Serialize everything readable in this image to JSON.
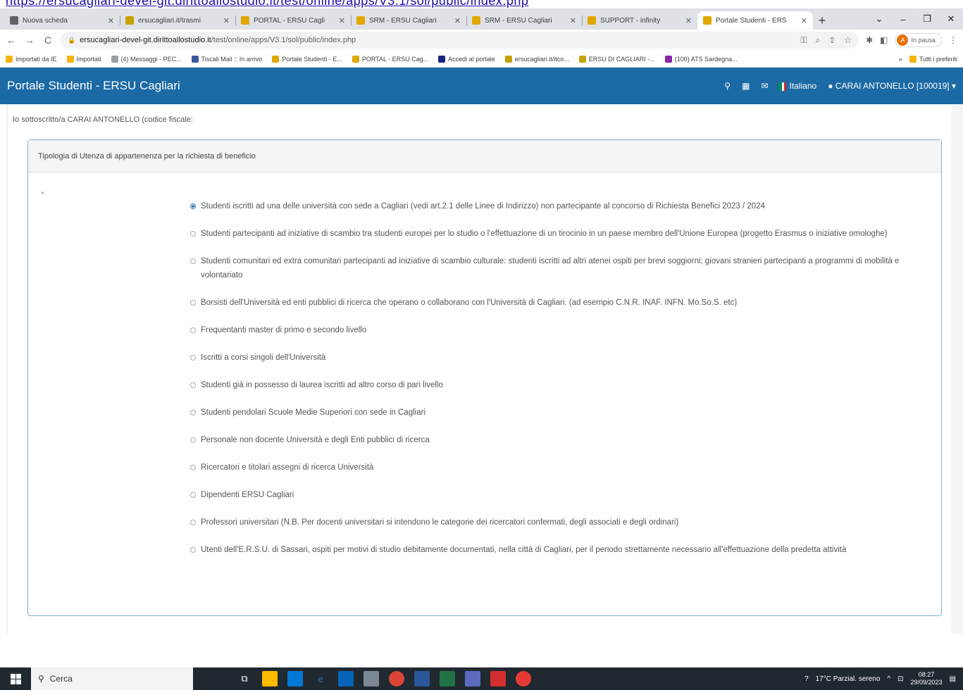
{
  "browser": {
    "tabs": [
      {
        "title": "Nuova scheda",
        "color": "#5f6368"
      },
      {
        "title": "ersucagliari.it/trasmi",
        "color": "#c8a200"
      },
      {
        "title": "PORTAL - ERSU Cagli",
        "color": "#e0a800"
      },
      {
        "title": "SRM - ERSU Cagliari",
        "color": "#e0a800"
      },
      {
        "title": "SRM - ERSU Cagliari",
        "color": "#e0a800"
      },
      {
        "title": "SUPPORT - infinity",
        "color": "#e0a800"
      },
      {
        "title": "Portale Studenti - ERS",
        "color": "#e0a800",
        "active": true
      }
    ],
    "url_host": "ersucagliari-devel-git.dirittoallostudio.it",
    "url_path": "/test/online/apps/V3.1/sol/public/index.php",
    "profile_status": "In pausa",
    "profile_initial": "A",
    "bookmarks": [
      {
        "label": "Importati da IE",
        "color": "#f4b400"
      },
      {
        "label": "Importati",
        "color": "#f4b400"
      },
      {
        "label": "(4) Messaggi - PEC...",
        "color": "#9aa0a6"
      },
      {
        "label": "Tiscali Mail :: In arrivo",
        "color": "#3b5998"
      },
      {
        "label": "Portale Studenti - E...",
        "color": "#e0a800"
      },
      {
        "label": "PORTAL - ERSU Cag...",
        "color": "#e0a800"
      },
      {
        "label": "Accedi al portale",
        "color": "#1a237e"
      },
      {
        "label": "ersucagliari.it/itco...",
        "color": "#c8a200"
      },
      {
        "label": "ERSU DI CAGLIARI -...",
        "color": "#c8a200"
      },
      {
        "label": "(100) ATS Sardegna...",
        "color": "#8e24aa"
      }
    ],
    "all_bookmarks": "Tutti i preferiti"
  },
  "portal": {
    "brand": "Portale Studenti - ERSU Cagliari",
    "language": "Italiano",
    "user": "CARAI ANTONELLO [100019]"
  },
  "form": {
    "intro": "Io sottoscritto/a CARAI ANTONELLO (codice fiscale:",
    "panel_title": "Tipologia di Utenza di appartenenza per la richiesta di beneficio",
    "required_mark": "*",
    "options": [
      {
        "label": "Studenti iscritti ad una delle università con sede a Cagliari (vedi art.2.1 delle Linee di Indirizzo) non partecipante al concorso di Richiesta Benefici 2023 / 2024",
        "selected": true
      },
      {
        "label": "Studenti partecipanti ad iniziative di scambio tra studenti europei per lo studio o l'effettuazione di un tirocinio in un paese membro dell'Unione Europea (progetto Erasmus o iniziative omologhe)",
        "selected": false
      },
      {
        "label": "Studenti comunitari ed extra comunitari partecipanti ad iniziative di scambio culturale: studenti iscritti ad altri atenei ospiti per brevi soggiorni; giovani stranieri partecipanti a programmi di mobilità e volontariato",
        "selected": false
      },
      {
        "label": "Borsisti dell'Università ed enti pubblici di ricerca che operano o collaborano con l'Università di Cagliari. (ad esempio C.N.R. INAF. INFN. Mo.So.S. etc)",
        "selected": false
      },
      {
        "label": "Frequentanti master di primo e secondo livello",
        "selected": false
      },
      {
        "label": "Iscritti a corsi singoli dell'Università",
        "selected": false
      },
      {
        "label": "Studenti già in possesso di laurea iscritti ad altro corso di pari livello",
        "selected": false
      },
      {
        "label": "Studenti pendolari Scuole Medie Superiori con sede in Cagliari",
        "selected": false
      },
      {
        "label": "Personale non docente Università e degli Enti pubblici di ricerca",
        "selected": false
      },
      {
        "label": "Ricercatori e titolari assegni di ricerca Università",
        "selected": false
      },
      {
        "label": "Dipendenti ERSU Cagliari",
        "selected": false
      },
      {
        "label": "Professori universitari (N.B. Per docenti universitari si intendono le categorie dei ricercatori confermati, degli associati e degli ordinari)",
        "selected": false
      },
      {
        "label": "Utenti dell'E.R.S.U. di Sassari, ospiti per motivi di studio debitamente documentati, nella città di Cagliari, per il periodo strettamente necessario all'effettuazione della predetta attività",
        "selected": false
      }
    ]
  },
  "taskbar": {
    "search_placeholder": "Cerca",
    "weather": "17°C Parzial. sereno",
    "time": "08:27",
    "date": "29/09/2023"
  }
}
